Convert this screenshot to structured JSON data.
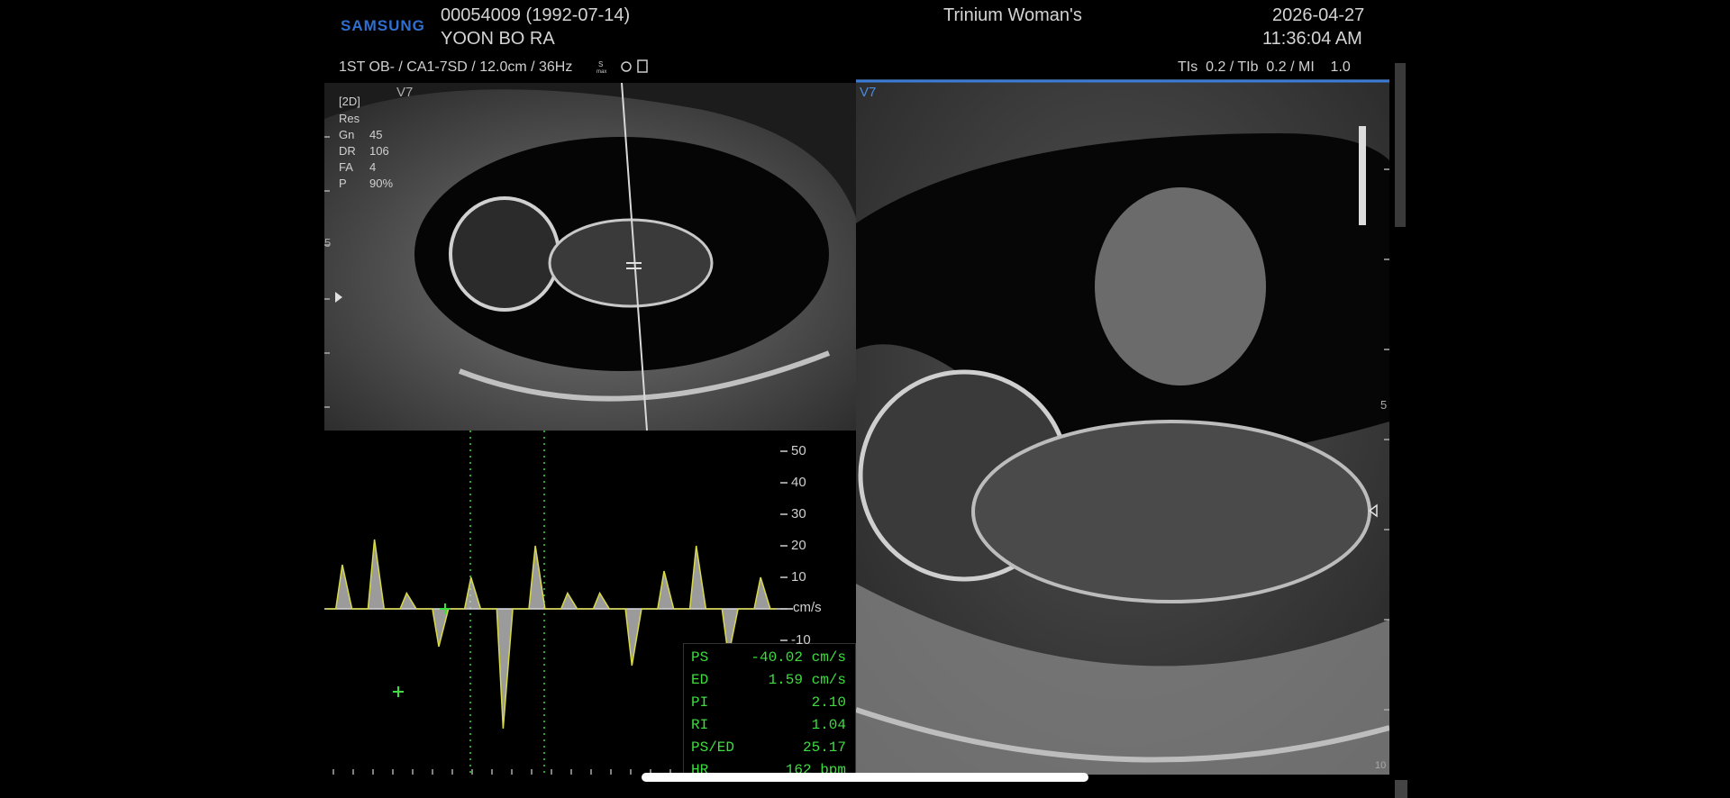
{
  "header": {
    "brand": "SAMSUNG",
    "patient_id": "00054009 (1992-07-14)",
    "patient_name": "YOON BO RA",
    "institution": "Trinium Woman's",
    "date": "2026-04-27",
    "time": "11:36:04 AM",
    "exam_info": "1ST OB- / CA1-7SD / 12.0cm / 36Hz",
    "thermal_label": "TIs  0.2 / TIb  0.2 / MI    1.0"
  },
  "left_panel": {
    "view_label": "V7",
    "mode": "[2D]",
    "params": [
      {
        "k": "Res",
        "v": ""
      },
      {
        "k": "Gn",
        "v": "45"
      },
      {
        "k": "DR",
        "v": "106"
      },
      {
        "k": "FA",
        "v": "4"
      },
      {
        "k": "P",
        "v": "90%"
      }
    ],
    "depth_marker": "5"
  },
  "right_panel": {
    "view_label": "V7",
    "depth_marker": "5",
    "bottom_marker": "10"
  },
  "doppler": {
    "unit": "cm/s",
    "scale_labels": [
      "50",
      "40",
      "30",
      "20",
      "10",
      "",
      "-10"
    ],
    "peak_velocities_cm_s": [
      14,
      22,
      5,
      -12,
      10,
      -38,
      20,
      5,
      5,
      -18,
      12,
      20,
      -15,
      10
    ],
    "measurements": [
      {
        "k": "PS",
        "v": "-40.02  cm/s"
      },
      {
        "k": "ED",
        "v": "1.59  cm/s"
      },
      {
        "k": "PI",
        "v": "2.10"
      },
      {
        "k": "RI",
        "v": "1.04"
      },
      {
        "k": "PS/ED",
        "v": "25.17"
      },
      {
        "k": "HR",
        "v": "162  bpm"
      }
    ]
  },
  "colors": {
    "brand_blue": "#2f6fd0",
    "measure_green": "#3fdc3f",
    "trace_yellow": "#d8d84a",
    "accent_blue": "#3a7bd5"
  }
}
